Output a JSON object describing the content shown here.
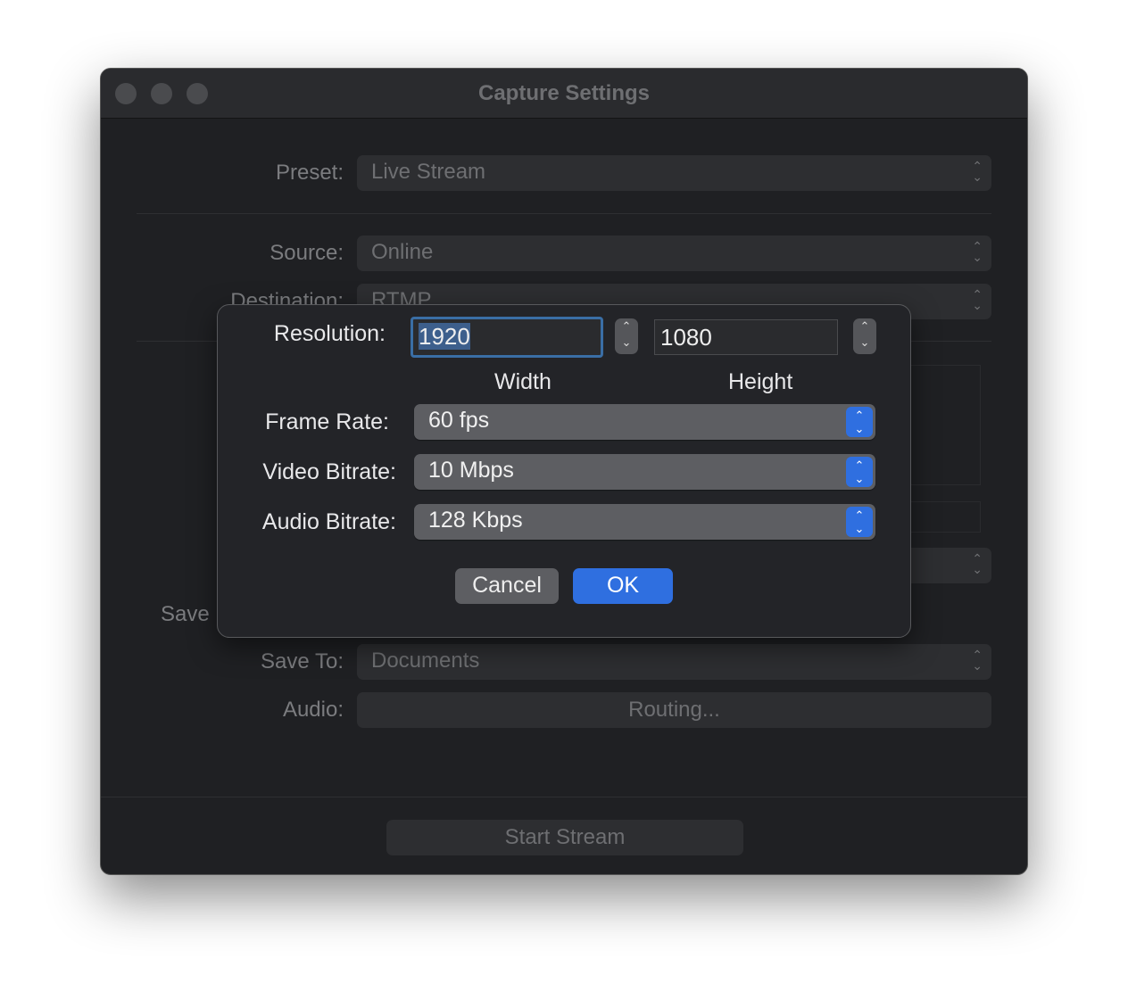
{
  "window": {
    "title": "Capture Settings"
  },
  "form": {
    "preset": {
      "label": "Preset:",
      "value": "Live Stream"
    },
    "source": {
      "label": "Source:",
      "value": "Online"
    },
    "destination": {
      "label": "Destination:",
      "value": "RTMP"
    },
    "save_label": "Save",
    "save_to": {
      "label": "Save To:",
      "value": "Documents"
    },
    "audio": {
      "label": "Audio:",
      "button": "Routing..."
    },
    "start_button": "Start Stream"
  },
  "sheet": {
    "resolution_label": "Resolution:",
    "width_value": "1920",
    "height_value": "1080",
    "width_caption": "Width",
    "height_caption": "Height",
    "frame_rate": {
      "label": "Frame Rate:",
      "value": "60 fps"
    },
    "video_bitrate": {
      "label": "Video Bitrate:",
      "value": "10 Mbps"
    },
    "audio_bitrate": {
      "label": "Audio Bitrate:",
      "value": "128 Kbps"
    },
    "cancel": "Cancel",
    "ok": "OK"
  },
  "colors": {
    "accent": "#2f6fe0",
    "window_bg": "#1f2023"
  }
}
